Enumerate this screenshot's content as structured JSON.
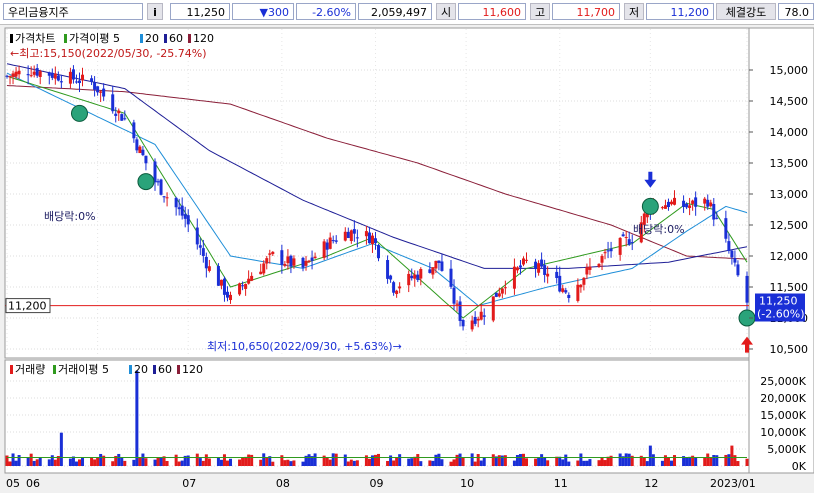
{
  "header": {
    "stock_name": "우리금융지주",
    "info_button": "i",
    "price": "11,250",
    "change": "▼300",
    "change_pct": "-2.60%",
    "volume": "2,059,497",
    "open_label": "시",
    "open": "11,600",
    "high_label": "고",
    "high": "11,700",
    "low_label": "저",
    "low": "11,200",
    "strength_label": "체결강도",
    "strength": "78.0"
  },
  "colors": {
    "up": "#e21b1b",
    "down": "#1a2fd6",
    "ma5": "#2f9a1e",
    "ma20": "#1e8ed8",
    "ma60": "#1e1e96",
    "ma120": "#8a1e38",
    "marker": "#2aa37a"
  },
  "price_panel": {
    "legend": [
      {
        "label": "가격차트",
        "color": "#000000"
      },
      {
        "label": "가격이평 5",
        "color": "#2f9a1e"
      },
      {
        "label": "20",
        "color": "#1e8ed8"
      },
      {
        "label": "60",
        "color": "#1e1e96"
      },
      {
        "label": "120",
        "color": "#8a1e38"
      }
    ],
    "high_annotation": "←최고:15,150(2022/05/30, -25.74%)",
    "low_annotation": "최저:10,650(2022/09/30, +5.63%)→",
    "dividend_label_1": "배당락:0%",
    "dividend_label_2": "배당락:0%",
    "current_price_tag": "11,250",
    "current_pct_tag": "(-2.60%)",
    "reference_line_label": "11,200",
    "y_ticks": [
      "15,000",
      "14,500",
      "14,000",
      "13,500",
      "13,000",
      "12,500",
      "12,000",
      "11,500",
      "11,000",
      "10,500"
    ]
  },
  "volume_panel": {
    "legend": [
      {
        "label": "거래량",
        "color": "#e21b1b"
      },
      {
        "label": "거래이평 5",
        "color": "#2f9a1e"
      },
      {
        "label": "20",
        "color": "#1e8ed8"
      },
      {
        "label": "60",
        "color": "#1e1e96"
      },
      {
        "label": "120",
        "color": "#8a1e38"
      }
    ],
    "y_ticks": [
      "25,000K",
      "20,000K",
      "15,000K",
      "10,000K",
      "5,000K",
      "0K"
    ]
  },
  "x_axis": {
    "labels": [
      "05",
      "06",
      "07",
      "08",
      "09",
      "10",
      "11",
      "12",
      "2023/01"
    ]
  },
  "chart_data": {
    "type": "candlestick",
    "price_ylim": [
      10500,
      15000
    ],
    "volume_ylim_k": [
      0,
      25000
    ],
    "start": "2022-05-02",
    "end": "2023-01-02",
    "highest": {
      "value": 15150,
      "date": "2022/05/30",
      "pct": -25.74
    },
    "lowest": {
      "value": 10650,
      "date": "2022/09/30",
      "pct": 5.63
    },
    "last_close": 11250,
    "reference_line": 11200,
    "price_keypoints": [
      {
        "date": "2022-05-02",
        "close": 14900
      },
      {
        "date": "2022-05-10",
        "close": 15000
      },
      {
        "date": "2022-05-30",
        "close": 14800
      },
      {
        "date": "2022-06-10",
        "close": 14200
      },
      {
        "date": "2022-06-20",
        "close": 13200
      },
      {
        "date": "2022-06-30",
        "close": 12600
      },
      {
        "date": "2022-07-08",
        "close": 11800
      },
      {
        "date": "2022-07-15",
        "close": 11300
      },
      {
        "date": "2022-07-22",
        "close": 11700
      },
      {
        "date": "2022-07-29",
        "close": 12000
      },
      {
        "date": "2022-08-08",
        "close": 11800
      },
      {
        "date": "2022-08-16",
        "close": 12200
      },
      {
        "date": "2022-08-23",
        "close": 12400
      },
      {
        "date": "2022-08-31",
        "close": 12300
      },
      {
        "date": "2022-09-07",
        "close": 11500
      },
      {
        "date": "2022-09-15",
        "close": 11700
      },
      {
        "date": "2022-09-22",
        "close": 11900
      },
      {
        "date": "2022-09-30",
        "close": 10900
      },
      {
        "date": "2022-10-07",
        "close": 11100
      },
      {
        "date": "2022-10-14",
        "close": 11600
      },
      {
        "date": "2022-10-21",
        "close": 11900
      },
      {
        "date": "2022-10-28",
        "close": 11700
      },
      {
        "date": "2022-11-04",
        "close": 11400
      },
      {
        "date": "2022-11-11",
        "close": 11800
      },
      {
        "date": "2022-11-18",
        "close": 12100
      },
      {
        "date": "2022-11-25",
        "close": 12300
      },
      {
        "date": "2022-12-01",
        "close": 12800
      },
      {
        "date": "2022-12-07",
        "close": 12850
      },
      {
        "date": "2022-12-13",
        "close": 12800
      },
      {
        "date": "2022-12-20",
        "close": 12900
      },
      {
        "date": "2022-12-26",
        "close": 12200
      },
      {
        "date": "2022-12-29",
        "close": 11800
      },
      {
        "date": "2023-01-02",
        "close": 11250
      }
    ],
    "ma5_keypoints": [
      {
        "date": "2022-05-02",
        "value": 14900
      },
      {
        "date": "2022-06-10",
        "value": 14300
      },
      {
        "date": "2022-06-30",
        "value": 12700
      },
      {
        "date": "2022-07-15",
        "value": 11500
      },
      {
        "date": "2022-08-16",
        "value": 12000
      },
      {
        "date": "2022-08-31",
        "value": 12300
      },
      {
        "date": "2022-09-30",
        "value": 11000
      },
      {
        "date": "2022-10-21",
        "value": 11800
      },
      {
        "date": "2022-11-25",
        "value": 12200
      },
      {
        "date": "2022-12-13",
        "value": 12850
      },
      {
        "date": "2022-12-22",
        "value": 12750
      },
      {
        "date": "2023-01-02",
        "value": 11900
      }
    ],
    "ma20_keypoints": [
      {
        "date": "2022-05-02",
        "value": 14950
      },
      {
        "date": "2022-06-20",
        "value": 13800
      },
      {
        "date": "2022-07-15",
        "value": 12000
      },
      {
        "date": "2022-08-08",
        "value": 11800
      },
      {
        "date": "2022-08-31",
        "value": 12200
      },
      {
        "date": "2022-09-20",
        "value": 11800
      },
      {
        "date": "2022-10-05",
        "value": 11200
      },
      {
        "date": "2022-10-28",
        "value": 11500
      },
      {
        "date": "2022-11-25",
        "value": 11800
      },
      {
        "date": "2022-12-13",
        "value": 12400
      },
      {
        "date": "2022-12-26",
        "value": 12800
      },
      {
        "date": "2023-01-02",
        "value": 12700
      }
    ],
    "ma60_keypoints": [
      {
        "date": "2022-05-02",
        "value": 15100
      },
      {
        "date": "2022-06-10",
        "value": 14700
      },
      {
        "date": "2022-07-08",
        "value": 13700
      },
      {
        "date": "2022-08-08",
        "value": 12900
      },
      {
        "date": "2022-09-07",
        "value": 12300
      },
      {
        "date": "2022-10-07",
        "value": 11800
      },
      {
        "date": "2022-11-04",
        "value": 11800
      },
      {
        "date": "2022-12-07",
        "value": 11900
      },
      {
        "date": "2023-01-02",
        "value": 12150
      }
    ],
    "ma120_keypoints": [
      {
        "date": "2022-05-02",
        "value": 14750
      },
      {
        "date": "2022-06-10",
        "value": 14650
      },
      {
        "date": "2022-07-15",
        "value": 14450
      },
      {
        "date": "2022-08-16",
        "value": 13900
      },
      {
        "date": "2022-09-15",
        "value": 13500
      },
      {
        "date": "2022-10-14",
        "value": 13000
      },
      {
        "date": "2022-11-18",
        "value": 12500
      },
      {
        "date": "2022-12-13",
        "value": 12000
      },
      {
        "date": "2023-01-02",
        "value": 11950
      }
    ],
    "volume_spikes_k": [
      {
        "date": "2022-06-14",
        "value": 28000
      },
      {
        "date": "2022-05-20",
        "value": 9800
      },
      {
        "date": "2022-12-01",
        "value": 6000
      },
      {
        "date": "2022-12-28",
        "value": 6000
      }
    ],
    "volume_typical_k": 2500,
    "markers": [
      {
        "date": "2022-05-26",
        "value": 14300,
        "kind": "circle"
      },
      {
        "date": "2022-06-17",
        "value": 13200,
        "kind": "circle"
      },
      {
        "date": "2022-12-01",
        "value": 12800,
        "kind": "circle"
      },
      {
        "date": "2023-01-02",
        "value": 11000,
        "kind": "circle"
      },
      {
        "date": "2022-12-01",
        "value": 13100,
        "kind": "down-arrow"
      },
      {
        "date": "2023-01-02",
        "value": 10700,
        "kind": "up-arrow"
      }
    ]
  }
}
